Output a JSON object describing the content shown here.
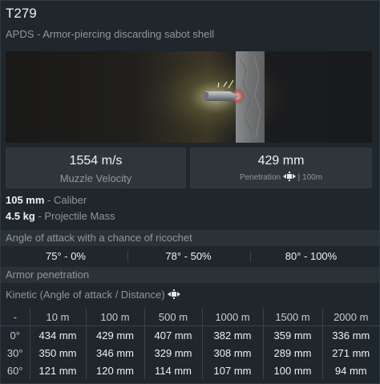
{
  "header": {
    "title": "T279",
    "subtitle": "APDS - Armor-piercing discarding sabot shell"
  },
  "stats": {
    "velocity_value": "1554 m/s",
    "velocity_label": "Muzzle Velocity",
    "penetration_value": "429 mm",
    "penetration_label": "Penetration",
    "penetration_distance": "100m"
  },
  "specs": {
    "caliber_value": "105 mm",
    "caliber_label": "- Caliber",
    "mass_value": "4.5 kg",
    "mass_label": "- Projectile Mass"
  },
  "ricochet": {
    "title": "Angle of attack with a chance of ricochet",
    "cells": [
      "75° - 0%",
      "78° - 50%",
      "80° - 100%"
    ]
  },
  "armor": {
    "title": "Armor penetration",
    "kinetic_label": "Kinetic (Angle of attack / Distance)",
    "headers": [
      "-",
      "10 m",
      "100 m",
      "500 m",
      "1000 m",
      "1500 m",
      "2000 m"
    ],
    "rows": [
      [
        "0°",
        "434 mm",
        "429 mm",
        "407 mm",
        "382 mm",
        "359 mm",
        "336 mm"
      ],
      [
        "30°",
        "350 mm",
        "346 mm",
        "329 mm",
        "308 mm",
        "289 mm",
        "271 mm"
      ],
      [
        "60°",
        "121 mm",
        "120 mm",
        "114 mm",
        "107 mm",
        "100 mm",
        "94 mm"
      ]
    ]
  },
  "icons": {
    "penetration": "crosshair-arrows-icon",
    "kinetic": "crosshair-arrows-icon",
    "preview": "shell-impact-illustration"
  },
  "colors": {
    "background": "#1f262c",
    "section": "#2a3238",
    "stat_box": "#2e363c",
    "text": "#f0f2f3",
    "muted": "#8e979e"
  }
}
